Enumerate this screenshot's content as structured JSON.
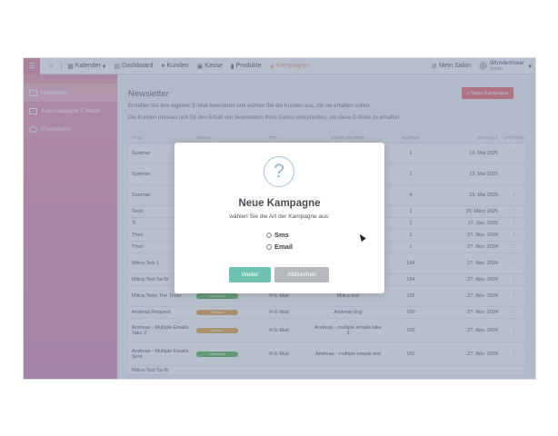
{
  "nav": {
    "calendar": "Kalender",
    "dashboard": "Dashboard",
    "customers": "Kunden",
    "cashier": "Kasse",
    "products": "Produkte",
    "campaigns": "Kampagnen",
    "salon": "Mein Salon",
    "user_name": "Wundermaar",
    "user_sub": "Admin"
  },
  "sidebar": {
    "items": [
      {
        "label": "Newsletter",
        "icon": "newsletter-icon"
      },
      {
        "label": "Automatisierte E-Mails",
        "icon": "auto-mail-icon"
      },
      {
        "label": "Promotions",
        "icon": "promotions-icon"
      }
    ]
  },
  "main": {
    "title": "Newsletter",
    "new_button": "+ Neue Kampagne",
    "desc1": "Erstellen Sie Ihre eigenen E-Mail-Newsletter und wählen Sie die Kunden aus, die sie erhalten sollen.",
    "desc2": "Die Kunden müssen sich für den Erhalt von Newslettern Ihres Salons entscheiden, um diese E-Mails zu erhalten."
  },
  "table": {
    "headers": [
      "TITEL",
      "STATUS",
      "TYP",
      "E-MAIL-BETREFF",
      "NUMMER",
      "ERSTELLT",
      "OPTIONEN"
    ],
    "rows": [
      {
        "title": "Summer",
        "status": "",
        "type": "",
        "subject": "",
        "number": "1",
        "date": "13. Mai 2025"
      },
      {
        "title": "Summer",
        "status": "",
        "type": "",
        "subject": "",
        "number": "1",
        "date": "13. Mai 2025"
      },
      {
        "title": "Summer",
        "status": "",
        "type": "",
        "subject": "",
        "number": "4",
        "date": "13. Mai 2025"
      },
      {
        "title": "Tests",
        "status": "",
        "type": "",
        "subject": "",
        "number": "1",
        "date": "26. März 2025"
      },
      {
        "title": "Ti",
        "status": "",
        "type": "",
        "subject": "",
        "number": "1",
        "date": "17. Jan. 2025"
      },
      {
        "title": "Theo",
        "status": "",
        "type": "",
        "subject": "",
        "number": "1",
        "date": "27. Nov. 2024"
      },
      {
        "title": "Theo",
        "status": "",
        "type": "",
        "subject": "",
        "number": "1",
        "date": "27. Nov. 2024"
      },
      {
        "title": "Milica Test 1",
        "status": "",
        "type": "",
        "subject": "",
        "number": "154",
        "date": "27. Nov. 2024"
      },
      {
        "title": "Milica Test Sa Br",
        "status": "",
        "type": "",
        "subject": "",
        "number": "154",
        "date": "27. Nov. 2024"
      },
      {
        "title": "Milica Tests The Timer",
        "status": "Gesendet",
        "type": "E-Mail",
        "subject": "Milica test",
        "number": "155",
        "date": "27. Nov. 2024"
      },
      {
        "title": "Andreas Request",
        "status": "Entwurf",
        "type": "E-Mail",
        "subject": "Andreas bug",
        "number": "150",
        "date": "27. Nov. 2024"
      },
      {
        "title": "Andreas - Multiple Emails Take 2",
        "status": "Entwurf",
        "type": "E-Mail",
        "subject": "Andreas - multiple emails take 2",
        "number": "153",
        "date": "27. Nov. 2024"
      },
      {
        "title": "Andreas - Multiple Emails Sent",
        "status": "Gesendet",
        "type": "E-Mail",
        "subject": "Andreas - multiple emails test",
        "number": "152",
        "date": "27. Nov. 2024"
      },
      {
        "title": "Milica Test Sa Br",
        "status": "",
        "type": "",
        "subject": "",
        "number": "",
        "date": ""
      }
    ]
  },
  "modal": {
    "icon": "question-icon",
    "icon_glyph": "?",
    "title": "Neue Kampagne",
    "subtitle": "wählen Sie die Art der Kampagne aus:",
    "options": [
      "Sms",
      "Email"
    ],
    "confirm": "Weiter",
    "cancel": "Abbrechen"
  },
  "colors": {
    "accent": "#ef6e74",
    "confirm": "#6ec2b4",
    "cancel": "#b5b9be",
    "sidebar": "#f09aae"
  }
}
